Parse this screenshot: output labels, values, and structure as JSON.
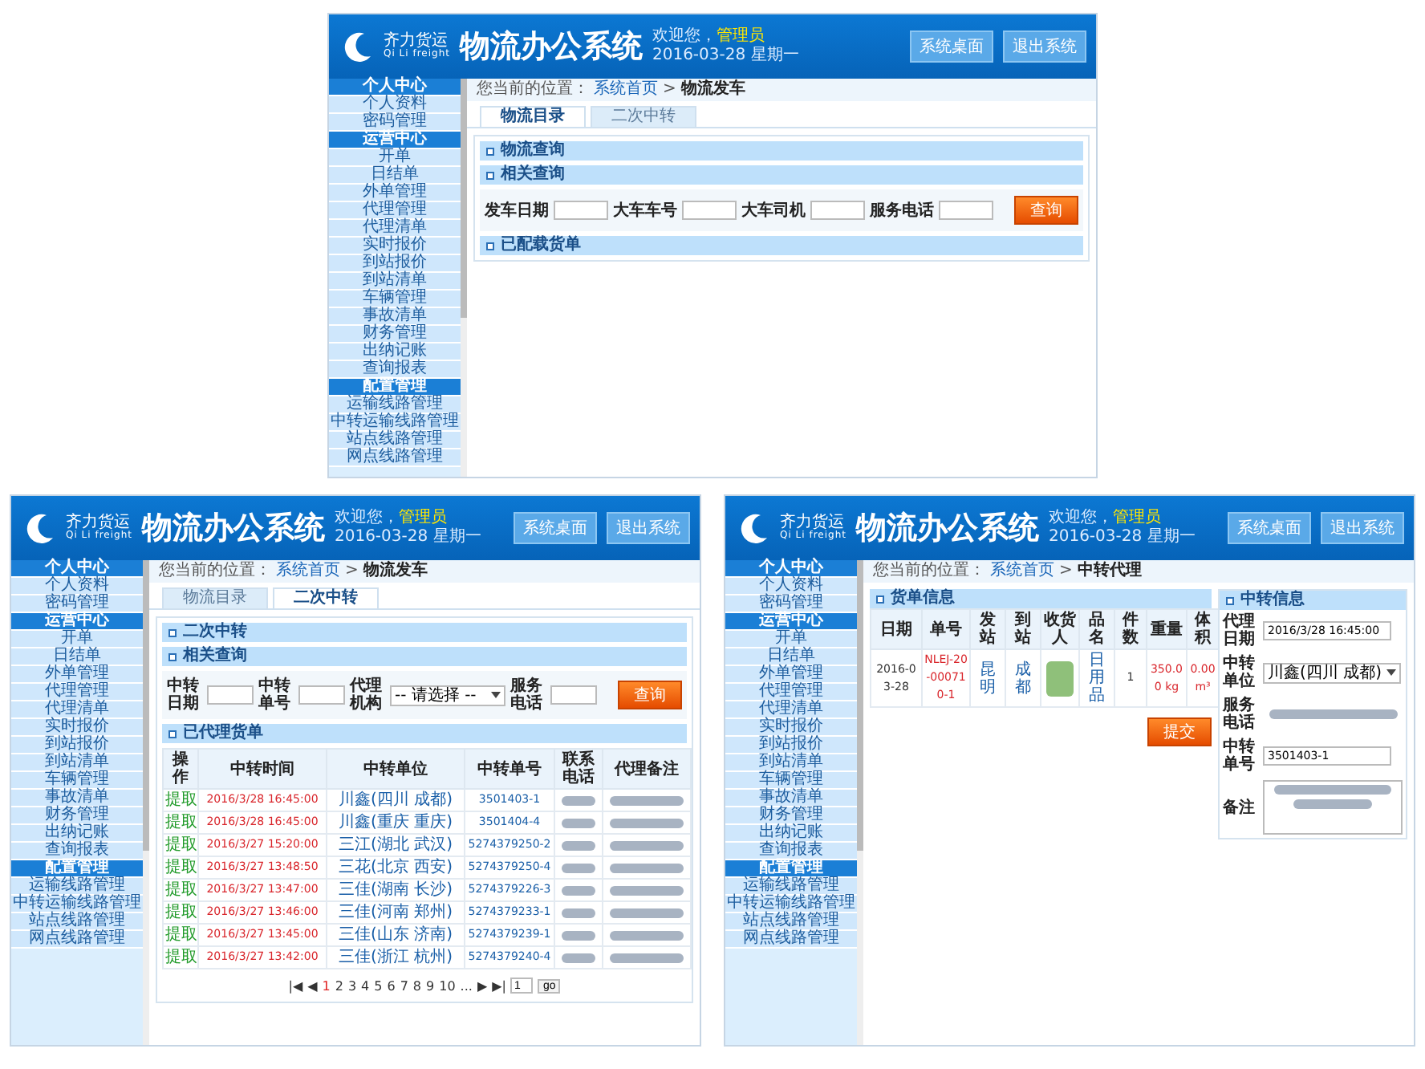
{
  "screens": [
    {
      "header": {
        "brand": "齐力货运",
        "brand_en": "Qi Li freight",
        "title": "物流办公系统",
        "greeting": "欢迎您，",
        "user": "管理员",
        "date": "2016-03-28 星期一",
        "buttons": [
          "系统桌面",
          "退出系统"
        ]
      },
      "sidebar": [
        {
          "label": "个人中心",
          "kind": "section"
        },
        {
          "label": "个人资料",
          "kind": "item"
        },
        {
          "label": "密码管理",
          "kind": "item"
        },
        {
          "label": "运营中心",
          "kind": "section"
        },
        {
          "label": "开单",
          "kind": "item"
        },
        {
          "label": "日结单",
          "kind": "item"
        },
        {
          "label": "外单管理",
          "kind": "item"
        },
        {
          "label": "代理管理",
          "kind": "item"
        },
        {
          "label": "代理清单",
          "kind": "item"
        },
        {
          "label": "实时报价",
          "kind": "item"
        },
        {
          "label": "到站报价",
          "kind": "item"
        },
        {
          "label": "到站清单",
          "kind": "item"
        },
        {
          "label": "车辆管理",
          "kind": "item"
        },
        {
          "label": "事故清单",
          "kind": "item"
        },
        {
          "label": "财务管理",
          "kind": "item"
        },
        {
          "label": "出纳记账",
          "kind": "item"
        },
        {
          "label": "查询报表",
          "kind": "item"
        },
        {
          "label": "配置管理",
          "kind": "section"
        },
        {
          "label": "运输线路管理",
          "kind": "item"
        },
        {
          "label": "中转运输线路管理",
          "kind": "item"
        },
        {
          "label": "站点线路管理",
          "kind": "item"
        },
        {
          "label": "网点线路管理",
          "kind": "item"
        }
      ],
      "breadcrumb": {
        "prefix": "您当前的位置：",
        "home": "系统首页",
        "separator": ">",
        "current": "物流发车"
      },
      "tabs": [
        {
          "label": "物流目录",
          "selected": true
        },
        {
          "label": "二次中转",
          "selected": false
        }
      ],
      "content": {
        "kind": "search",
        "title": "物流查询",
        "query_title": "相关查询",
        "fields": [
          {
            "label": "发车日期",
            "kind": "input"
          },
          {
            "label": "大车车号",
            "kind": "input"
          },
          {
            "label": "大车司机",
            "kind": "input"
          },
          {
            "label": "服务电话",
            "kind": "input"
          }
        ],
        "button": "查询",
        "result_title": "已配载货单"
      }
    },
    {
      "header": {
        "brand": "齐力货运",
        "brand_en": "Qi Li freight",
        "title": "物流办公系统",
        "greeting": "欢迎您，",
        "user": "管理员",
        "date": "2016-03-28 星期一",
        "buttons": [
          "系统桌面",
          "退出系统"
        ]
      },
      "sidebar": [
        {
          "label": "个人中心",
          "kind": "section"
        },
        {
          "label": "个人资料",
          "kind": "item"
        },
        {
          "label": "密码管理",
          "kind": "item"
        },
        {
          "label": "运营中心",
          "kind": "section"
        },
        {
          "label": "开单",
          "kind": "item"
        },
        {
          "label": "日结单",
          "kind": "item"
        },
        {
          "label": "外单管理",
          "kind": "item"
        },
        {
          "label": "代理管理",
          "kind": "item"
        },
        {
          "label": "代理清单",
          "kind": "item"
        },
        {
          "label": "实时报价",
          "kind": "item"
        },
        {
          "label": "到站报价",
          "kind": "item"
        },
        {
          "label": "到站清单",
          "kind": "item"
        },
        {
          "label": "车辆管理",
          "kind": "item"
        },
        {
          "label": "事故清单",
          "kind": "item"
        },
        {
          "label": "财务管理",
          "kind": "item"
        },
        {
          "label": "出纳记账",
          "kind": "item"
        },
        {
          "label": "查询报表",
          "kind": "item"
        },
        {
          "label": "配置管理",
          "kind": "section"
        },
        {
          "label": "运输线路管理",
          "kind": "item"
        },
        {
          "label": "中转运输线路管理",
          "kind": "item"
        },
        {
          "label": "站点线路管理",
          "kind": "item"
        },
        {
          "label": "网点线路管理",
          "kind": "item"
        }
      ],
      "breadcrumb": {
        "prefix": "您当前的位置：",
        "home": "系统首页",
        "separator": ">",
        "current": "物流发车"
      },
      "tabs": [
        {
          "label": "物流目录",
          "selected": false
        },
        {
          "label": "二次中转",
          "selected": true
        }
      ],
      "content": {
        "kind": "list",
        "title": "二次中转",
        "query_title": "相关查询",
        "fields": [
          {
            "label": "中转日期",
            "kind": "input"
          },
          {
            "label": "中转单号",
            "kind": "input"
          },
          {
            "label": "代理机构",
            "kind": "select",
            "value": "-- 请选择 --"
          },
          {
            "label": "服务电话",
            "kind": "input"
          }
        ],
        "button": "查询",
        "result_title": "已代理货单",
        "columns": [
          "操作",
          "中转时间",
          "中转单位",
          "中转单号",
          "联系电话",
          "代理备注"
        ],
        "rows": [
          {
            "action": "提取",
            "time": "2016/3/28 16:45:00",
            "unit": "川鑫(四川 成都)",
            "number": "3501403-1"
          },
          {
            "action": "提取",
            "time": "2016/3/28 16:45:00",
            "unit": "川鑫(重庆 重庆)",
            "number": "3501404-4"
          },
          {
            "action": "提取",
            "time": "2016/3/27 15:20:00",
            "unit": "三江(湖北 武汉)",
            "number": "5274379250-2"
          },
          {
            "action": "提取",
            "time": "2016/3/27 13:48:50",
            "unit": "三花(北京 西安)",
            "number": "5274379250-4"
          },
          {
            "action": "提取",
            "time": "2016/3/27 13:47:00",
            "unit": "三佳(湖南 长沙)",
            "number": "5274379226-3"
          },
          {
            "action": "提取",
            "time": "2016/3/27 13:46:00",
            "unit": "三佳(河南 郑州)",
            "number": "5274379233-1"
          },
          {
            "action": "提取",
            "time": "2016/3/27 13:45:00",
            "unit": "三佳(山东 济南)",
            "number": "5274379239-1"
          },
          {
            "action": "提取",
            "time": "2016/3/27 13:42:00",
            "unit": "三佳(浙江 杭州)",
            "number": "5274379240-4"
          }
        ],
        "pager": {
          "first": "|◀",
          "prev": "◀",
          "pages": [
            {
              "label": "1",
              "selected": true
            },
            {
              "label": "2",
              "selected": false
            },
            {
              "label": "3",
              "selected": false
            },
            {
              "label": "4",
              "selected": false
            },
            {
              "label": "5",
              "selected": false
            },
            {
              "label": "6",
              "selected": false
            },
            {
              "label": "7",
              "selected": false
            },
            {
              "label": "8",
              "selected": false
            },
            {
              "label": "9",
              "selected": false
            },
            {
              "label": "10",
              "selected": false
            }
          ],
          "more": "...",
          "next": "▶",
          "last": "▶|",
          "input": "1",
          "go": "go"
        }
      }
    },
    {
      "header": {
        "brand": "齐力货运",
        "brand_en": "Qi Li freight",
        "title": "物流办公系统",
        "greeting": "欢迎您，",
        "user": "管理员",
        "date": "2016-03-28 星期一",
        "buttons": [
          "系统桌面",
          "退出系统"
        ]
      },
      "sidebar": [
        {
          "label": "个人中心",
          "kind": "section"
        },
        {
          "label": "个人资料",
          "kind": "item"
        },
        {
          "label": "密码管理",
          "kind": "item"
        },
        {
          "label": "运营中心",
          "kind": "section"
        },
        {
          "label": "开单",
          "kind": "item"
        },
        {
          "label": "日结单",
          "kind": "item"
        },
        {
          "label": "外单管理",
          "kind": "item"
        },
        {
          "label": "代理管理",
          "kind": "item"
        },
        {
          "label": "代理清单",
          "kind": "item"
        },
        {
          "label": "实时报价",
          "kind": "item"
        },
        {
          "label": "到站报价",
          "kind": "item"
        },
        {
          "label": "到站清单",
          "kind": "item"
        },
        {
          "label": "车辆管理",
          "kind": "item"
        },
        {
          "label": "事故清单",
          "kind": "item"
        },
        {
          "label": "财务管理",
          "kind": "item"
        },
        {
          "label": "出纳记账",
          "kind": "item"
        },
        {
          "label": "查询报表",
          "kind": "item"
        },
        {
          "label": "配置管理",
          "kind": "section"
        },
        {
          "label": "运输线路管理",
          "kind": "item"
        },
        {
          "label": "中转运输线路管理",
          "kind": "item"
        },
        {
          "label": "站点线路管理",
          "kind": "item"
        },
        {
          "label": "网点线路管理",
          "kind": "item"
        }
      ],
      "breadcrumb": {
        "prefix": "您当前的位置：",
        "home": "系统首页",
        "separator": ">",
        "current": "中转代理"
      },
      "content": {
        "kind": "detail",
        "table_title": "货单信息",
        "columns": [
          "日期",
          "单号",
          "发站",
          "到站",
          "收货人",
          "品名",
          "件数",
          "重量",
          "体积"
        ],
        "rows": [
          {
            "cells": [
              {
                "kind": "text",
                "text": "2016-03-28"
              },
              {
                "kind": "alert",
                "text": "NLEJ-20-000710-1"
              },
              {
                "kind": "link",
                "text": "昆明"
              },
              {
                "kind": "link",
                "text": "成都"
              },
              {
                "kind": "blurred"
              },
              {
                "kind": "link",
                "text": "日用品"
              },
              {
                "kind": "text",
                "text": "1"
              },
              {
                "kind": "alert",
                "text": "350.00 kg"
              },
              {
                "kind": "alert",
                "text": "0.00 m³"
              }
            ]
          }
        ],
        "button": "提交",
        "form_title": "中转信息",
        "fields": [
          {
            "label": "代理日期",
            "kind": "input",
            "value": "2016/3/28 16:45:00"
          },
          {
            "label": "中转单位",
            "kind": "select",
            "value": "川鑫(四川 成都)"
          },
          {
            "label": "服务电话",
            "kind": "blurred"
          },
          {
            "label": "中转单号",
            "kind": "input",
            "value": "3501403-1"
          },
          {
            "label": "备注",
            "kind": "textarea"
          }
        ]
      }
    }
  ]
}
